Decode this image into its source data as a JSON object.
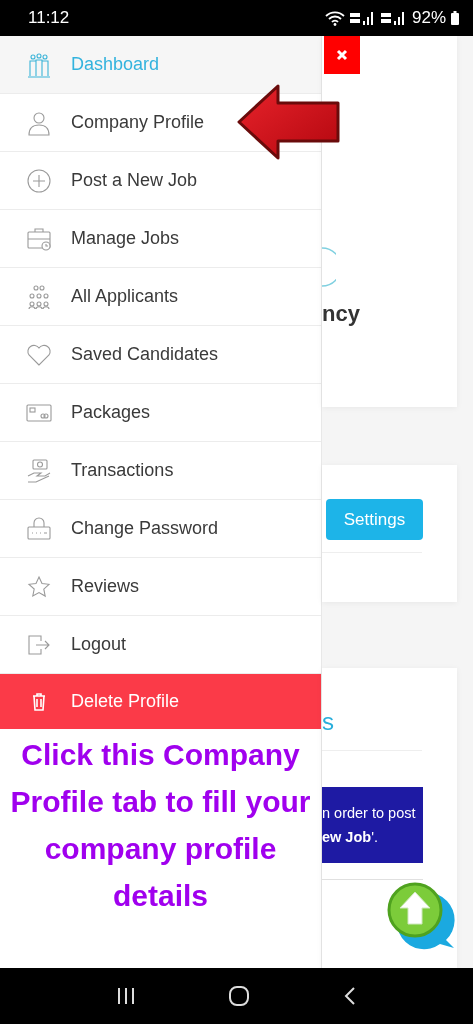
{
  "status_bar": {
    "time": "11:12",
    "battery": "92%"
  },
  "menu": {
    "items": [
      {
        "label": "Dashboard",
        "selected": true,
        "kind": "link"
      },
      {
        "label": "Company Profile",
        "selected": false,
        "kind": "link"
      },
      {
        "label": "Post a New Job",
        "selected": false,
        "kind": "link"
      },
      {
        "label": "Manage Jobs",
        "selected": false,
        "kind": "link"
      },
      {
        "label": "All Applicants",
        "selected": false,
        "kind": "link"
      },
      {
        "label": "Saved Candidates",
        "selected": false,
        "kind": "link"
      },
      {
        "label": "Packages",
        "selected": false,
        "kind": "link"
      },
      {
        "label": "Transactions",
        "selected": false,
        "kind": "link"
      },
      {
        "label": "Change Password",
        "selected": false,
        "kind": "link"
      },
      {
        "label": "Reviews",
        "selected": false,
        "kind": "link"
      },
      {
        "label": "Logout",
        "selected": false,
        "kind": "link"
      },
      {
        "label": "Delete Profile",
        "kind": "danger"
      }
    ]
  },
  "annotation": {
    "text": "Click this Company Profile tab to fill your company profile details"
  },
  "background_page": {
    "heading": "ncy",
    "button": "Settings",
    "heading_2": "s",
    "notice_lines": [
      "n order to post",
      "**ew Job**'."
    ]
  }
}
